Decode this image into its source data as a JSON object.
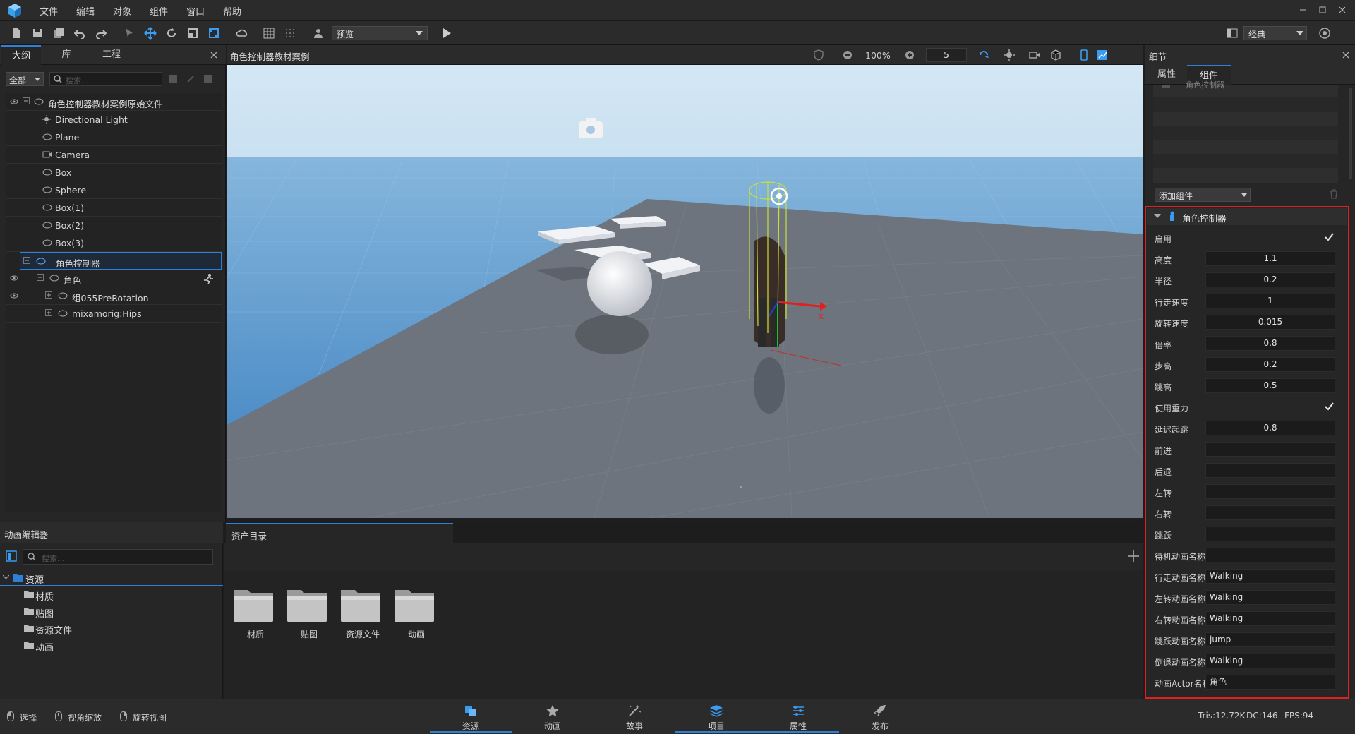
{
  "menu": {
    "file": "文件",
    "edit": "编辑",
    "object": "对象",
    "component": "组件",
    "window": "窗口",
    "help": "帮助"
  },
  "toolbar": {
    "preview_label": "预览",
    "layout_label": "经典"
  },
  "outline": {
    "tabs": [
      "大纲",
      "库",
      "工程"
    ],
    "filter": "全部",
    "search_placeholder": "搜索...",
    "items": [
      {
        "label": "角色控制器教材案例原始文件"
      },
      {
        "label": "Directional Light"
      },
      {
        "label": "Plane"
      },
      {
        "label": "Camera"
      },
      {
        "label": "Box"
      },
      {
        "label": "Sphere"
      },
      {
        "label": "Box(1)"
      },
      {
        "label": "Box(2)"
      },
      {
        "label": "Box(3)"
      },
      {
        "label": "角色控制器"
      },
      {
        "label": "角色"
      },
      {
        "label": "组055PreRotation"
      },
      {
        "label": "mixamorig:Hips"
      }
    ]
  },
  "viewport": {
    "title": "角色控制器教材案例",
    "zoom": "100%",
    "grid_value": "5",
    "axis_label": "x"
  },
  "details": {
    "title": "细节",
    "tabs": [
      "属性",
      "组件"
    ],
    "partial_item": "角色控制器",
    "add_component": "添加组件",
    "section_title": "角色控制器",
    "props": [
      {
        "label": "启用",
        "type": "check",
        "value": true
      },
      {
        "label": "高度",
        "type": "num",
        "value": "1.1"
      },
      {
        "label": "半径",
        "type": "num",
        "value": "0.2"
      },
      {
        "label": "行走速度",
        "type": "num",
        "value": "1"
      },
      {
        "label": "旋转速度",
        "type": "num",
        "value": "0.015"
      },
      {
        "label": "倍率",
        "type": "num",
        "value": "0.8"
      },
      {
        "label": "步高",
        "type": "num",
        "value": "0.2"
      },
      {
        "label": "跳高",
        "type": "num",
        "value": "0.5"
      },
      {
        "label": "使用重力",
        "type": "check",
        "value": true
      },
      {
        "label": "延迟起跳",
        "type": "num",
        "value": "0.8"
      },
      {
        "label": "前进",
        "type": "txt",
        "value": ""
      },
      {
        "label": "后退",
        "type": "txt",
        "value": ""
      },
      {
        "label": "左转",
        "type": "txt",
        "value": ""
      },
      {
        "label": "右转",
        "type": "txt",
        "value": ""
      },
      {
        "label": "跳跃",
        "type": "txt",
        "value": ""
      },
      {
        "label": "待机动画名称",
        "type": "txt",
        "value": ""
      },
      {
        "label": "行走动画名称",
        "type": "txt",
        "value": "Walking"
      },
      {
        "label": "左转动画名称",
        "type": "txt",
        "value": "Walking"
      },
      {
        "label": "右转动画名称",
        "type": "txt",
        "value": "Walking"
      },
      {
        "label": "跳跃动画名称",
        "type": "txt",
        "value": "jump"
      },
      {
        "label": "倒退动画名称",
        "type": "txt",
        "value": "Walking"
      },
      {
        "label": "动画Actor名称",
        "type": "txt",
        "value": "角色"
      }
    ]
  },
  "anim_editor": {
    "title": "动画编辑器",
    "search_placeholder": "搜索...",
    "tree": [
      "资源",
      "材质",
      "贴图",
      "资源文件",
      "动画"
    ]
  },
  "assets": {
    "tab": "资产目录",
    "folders": [
      "材质",
      "贴图",
      "资源文件",
      "动画"
    ]
  },
  "status": {
    "select": "选择",
    "zoom_view": "视角缩放",
    "rotate_view": "旋转视图",
    "tris": "Tris:12.72K",
    "dc": "DC:146",
    "fps": "FPS:94"
  },
  "bottom_tabs": [
    "资源",
    "动画",
    "故事",
    "项目",
    "属性",
    "发布"
  ],
  "colors": {
    "accent": "#2f7fd8",
    "highlight_border": "#e02020",
    "sky_top": "#b9d7ee",
    "ground": "#6e747d"
  }
}
